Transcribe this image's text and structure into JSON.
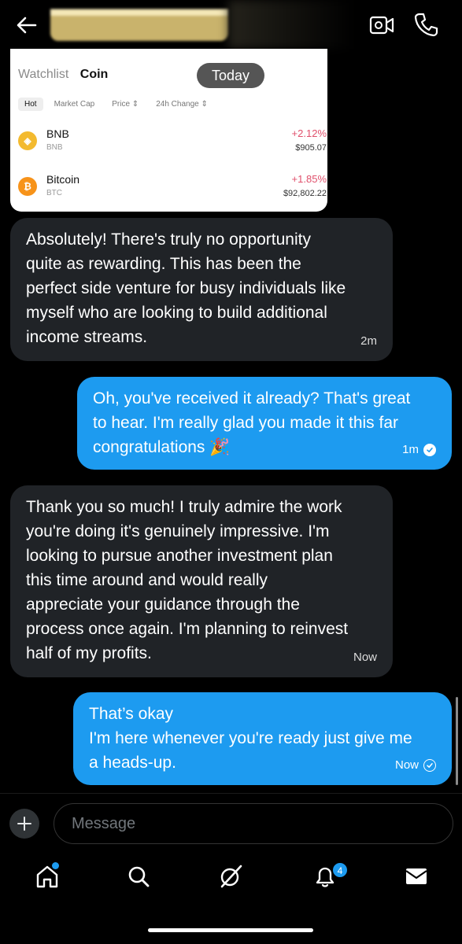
{
  "screenshot_card": {
    "tab_watchlist": "Watchlist",
    "tab_coin": "Coin",
    "today_label": "Today",
    "filters": [
      "Hot",
      "Market Cap",
      "Price ⇕",
      "24h Change ⇕"
    ],
    "coins": [
      {
        "name": "BNB",
        "symbol": "BNB",
        "change": "+2.12%",
        "price": "$905.07",
        "icon_color": "#f3ba2f"
      },
      {
        "name": "Bitcoin",
        "symbol": "BTC",
        "change": "+1.85%",
        "price": "$92,802.22",
        "icon_color": "#f7931a"
      }
    ]
  },
  "messages": [
    {
      "direction": "in",
      "text": "Absolutely! There's truly no opportunity\nquite as rewarding. This has been the\nperfect side venture for busy individuals like\nmyself who are looking to build additional\nincome streams.",
      "time": "2m"
    },
    {
      "direction": "out",
      "text": "Oh, you've received it already? That's great\nto hear. I'm really glad you made it this far\ncongratulations 🎉",
      "time": "1m",
      "status": "read"
    },
    {
      "direction": "in",
      "text": "Thank you so much! I truly admire the work\nyou're doing it's genuinely impressive. I'm\nlooking to pursue another investment plan\nthis time around and would really\nappreciate your guidance through the\nprocess once again. I'm planning to reinvest\nhalf of my profits.",
      "time": "Now"
    },
    {
      "direction": "out",
      "text": "That’s okay\nI'm here whenever you're ready just give me\na heads-up.",
      "time": "Now",
      "status": "sent"
    }
  ],
  "composer": {
    "placeholder": "Message"
  },
  "nav": {
    "notifications_badge": "4",
    "icons": [
      "home-icon",
      "search-icon",
      "grok-icon",
      "notifications-icon",
      "messages-icon"
    ]
  },
  "colors": {
    "accent": "#1d9bf0",
    "incoming_bubble": "#202327",
    "positive_change": "#e0506c"
  }
}
